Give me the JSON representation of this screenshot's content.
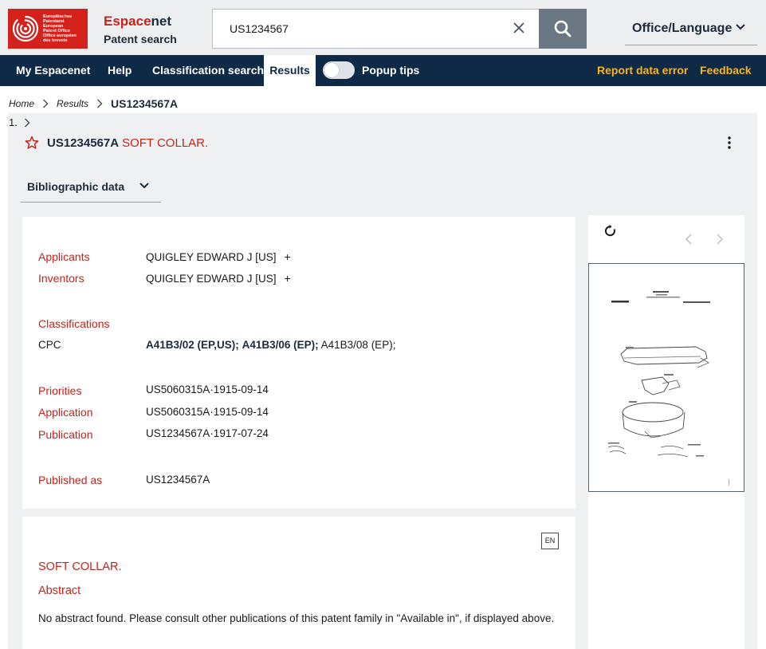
{
  "header": {
    "logo_lines": [
      "Europäisches",
      "Patentamt",
      "European",
      "Patent Office",
      "Office européen",
      "des brevets"
    ],
    "brand_name_part1": "Espace",
    "brand_name_part2": "net",
    "brand_tagline": "Patent search",
    "search_value": "US1234567",
    "office_language": "Office/Language"
  },
  "nav": {
    "items": [
      "My Espacenet",
      "Help",
      "Classification search",
      "Results"
    ],
    "active": "Results",
    "popup_tips": "Popup tips",
    "popup_tips_on": false,
    "report": "Report data error",
    "feedback": "Feedback"
  },
  "breadcrumb": {
    "home": "Home",
    "results": "Results",
    "current": "US1234567A"
  },
  "result": {
    "index": "1.",
    "number": "US1234567A",
    "title": "SOFT COLLAR.",
    "section": "Bibliographic data"
  },
  "biblio": {
    "applicants_label": "Applicants",
    "applicants_value": "QUIGLEY EDWARD J [US]",
    "inventors_label": "Inventors",
    "inventors_value": "QUIGLEY EDWARD J [US]",
    "expand": "+",
    "classifications_label": "Classifications",
    "cpc_label": "CPC",
    "cpc_1": "A41B3/02 (EP,US);",
    "cpc_2": "A41B3/06 (EP);",
    "cpc_3": "A41B3/08 (EP);",
    "priorities_label": "Priorities",
    "priorities_value": "US5060315A·1915-09-14",
    "application_label": "Application",
    "application_value": "US5060315A·1915-09-14",
    "publication_label": "Publication",
    "publication_value": "US1234567A·1917-07-24",
    "published_as_label": "Published as",
    "published_as_value": "US1234567A"
  },
  "abstract": {
    "lang": "EN",
    "title": "SOFT COLLAR.",
    "heading": "Abstract",
    "text": "No abstract found. Please consult other publications of this patent family in \"Available in\", if displayed above."
  },
  "colors": {
    "nav_bg": "#0e2a47",
    "accent_red": "#c6231b",
    "link_yellow": "#f7b422"
  }
}
